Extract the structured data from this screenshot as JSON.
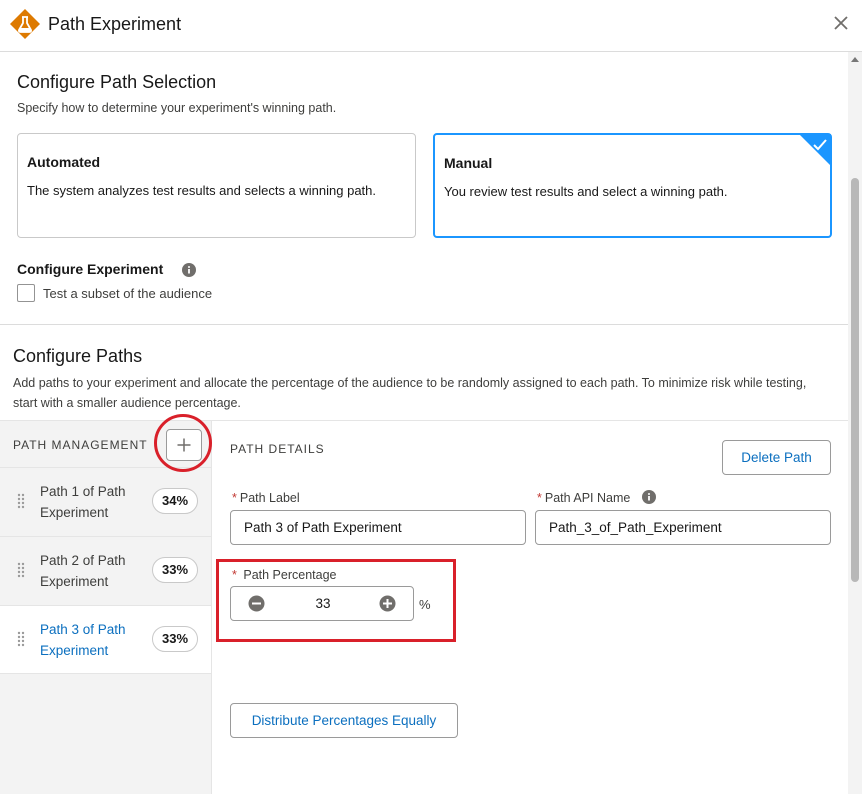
{
  "header": {
    "title": "Path Experiment",
    "app_icon": "flask-icon",
    "close_icon": "close-icon"
  },
  "selection": {
    "title": "Configure Path Selection",
    "description": "Specify how to determine your experiment's winning path.",
    "options": [
      {
        "title": "Automated",
        "description": "The system analyzes test results and selects a winning path.",
        "selected": false
      },
      {
        "title": "Manual",
        "description": "You review test results and select a winning path.",
        "selected": true
      }
    ]
  },
  "experiment": {
    "title": "Configure Experiment",
    "checkbox_label": "Test a subset of the audience",
    "checked": false
  },
  "paths": {
    "title": "Configure Paths",
    "description": "Add paths to your experiment and allocate the percentage of the audience to be randomly assigned to each path. To minimize risk while testing, start with a smaller audience percentage.",
    "management_label": "PATH MANAGEMENT",
    "items": [
      {
        "label": "Path 1 of Path Experiment",
        "percent": "34%"
      },
      {
        "label": "Path 2 of Path Experiment",
        "percent": "33%"
      },
      {
        "label": "Path 3 of Path Experiment",
        "percent": "33%",
        "active": true
      }
    ]
  },
  "details": {
    "title": "PATH DETAILS",
    "delete_label": "Delete Path",
    "label_field": {
      "label": "Path Label",
      "value": "Path 3 of Path Experiment"
    },
    "api_field": {
      "label": "Path API Name",
      "value": "Path_3_of_Path_Experiment"
    },
    "percentage_field": {
      "label": "Path Percentage",
      "value": "33",
      "unit": "%"
    },
    "distribute_label": "Distribute Percentages Equally"
  },
  "colors": {
    "accent": "#1b96ff",
    "link": "#0b6fbf",
    "annotation": "#d9202a",
    "brand_icon": "#dd7a01"
  }
}
